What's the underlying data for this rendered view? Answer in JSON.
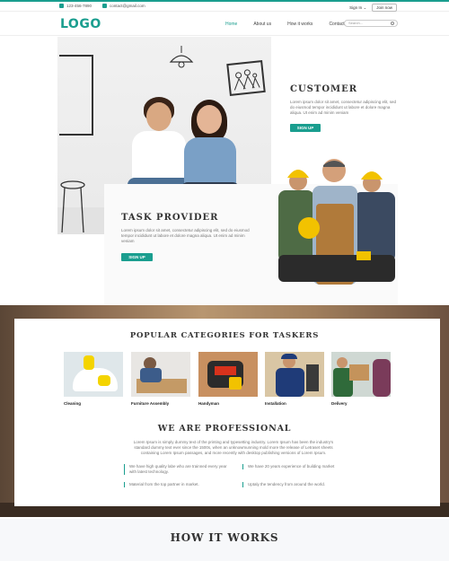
{
  "topbar": {
    "phone": "123-456-7890",
    "email": "contact@gmail.com",
    "signin": "Sign In",
    "signin_caret": "⌄",
    "joinnow": "Join now"
  },
  "header": {
    "logo": "LOGO",
    "nav": [
      "Home",
      "About us",
      "How it works",
      "Contact"
    ],
    "search_placeholder": "Search..."
  },
  "customer": {
    "title": "CUSTOMER",
    "text": "Lorem ipsum dolor sit amet, consectetur adipiscing elit, sed do eiusmod tempor incididunt ut labore et dolore magna aliqua. Ut enim ad minim veniam",
    "button": "SIGN UP"
  },
  "task_provider": {
    "title": "TASK PROVIDER",
    "text": "Lorem ipsum dolor sit amet, consectetur adipiscing elit, sed do eiusmod tempor incididunt ut labore et dolore magna aliqua. Ut enim ad minim veniam",
    "button": "SIGN UP"
  },
  "categories": {
    "title": "POPULAR CATEGORIES FOR TASKERS",
    "items": [
      {
        "label": "Cleaning"
      },
      {
        "label": "Furniture Assembly"
      },
      {
        "label": "Handyman"
      },
      {
        "label": "Installation"
      },
      {
        "label": "Delivery"
      }
    ]
  },
  "professional": {
    "title": "WE ARE PROFESSIONAL",
    "text": "Lorem Ipsum is simply dummy text of the printing and typesetting industry. Lorem Ipsum has been the industry's standard dummy text ever since the 1500s, when an unknowmunning mold more the release of Letraset sheets containing Lorem Ipsum passages, and more recently with desktop publishing versions of Lorem Ipsum.",
    "features": [
      "We have high quality labe who are trainned every year with latest technology.",
      "We have 20 years experience of building market",
      "Material from the top partner in market.",
      "Uptaly the tendency from around the world."
    ]
  },
  "how": {
    "title": "HOW IT WORKS"
  },
  "colors": {
    "accent": "#1a9e8f"
  }
}
